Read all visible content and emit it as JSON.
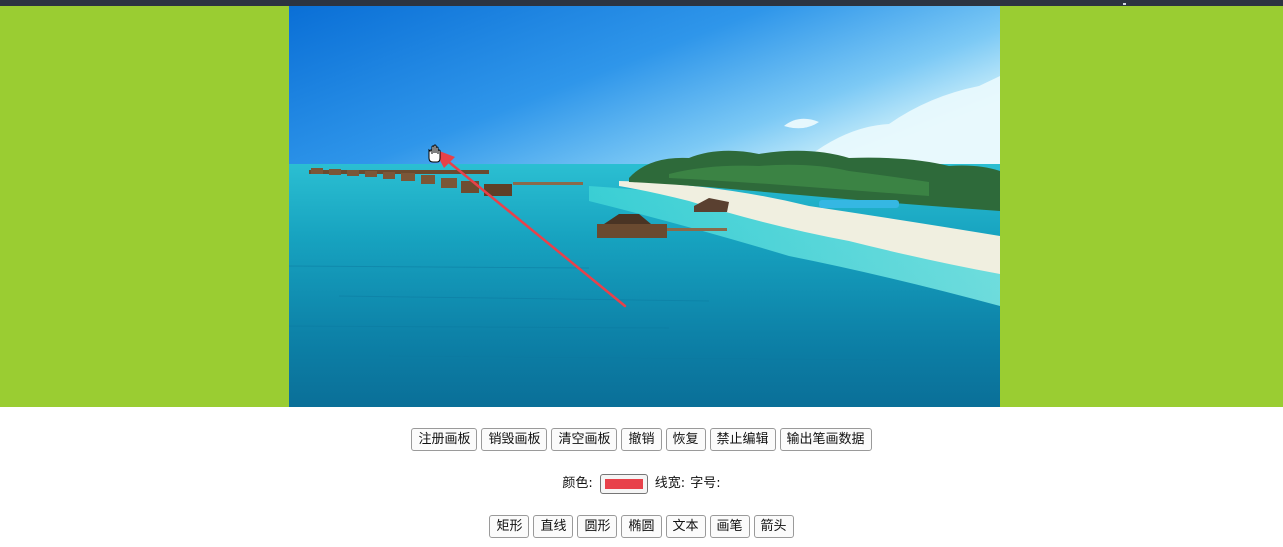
{
  "toolbar_row1": {
    "buttons": [
      "注册画板",
      "销毁画板",
      "清空画板",
      "撤销",
      "恢复",
      "禁止编辑",
      "输出笔画数据"
    ]
  },
  "settings": {
    "color_label": "颜色:",
    "color_value": "#e8414a",
    "line_width_label": "线宽:",
    "font_size_label": "字号:"
  },
  "toolbar_row3": {
    "buttons": [
      "矩形",
      "直线",
      "圆形",
      "椭圆",
      "文本",
      "画笔",
      "箭头"
    ]
  },
  "canvas": {
    "stage_color": "#9acd32",
    "arrow_color": "#e8414a",
    "cursor_icon": "hand-grab-icon"
  }
}
